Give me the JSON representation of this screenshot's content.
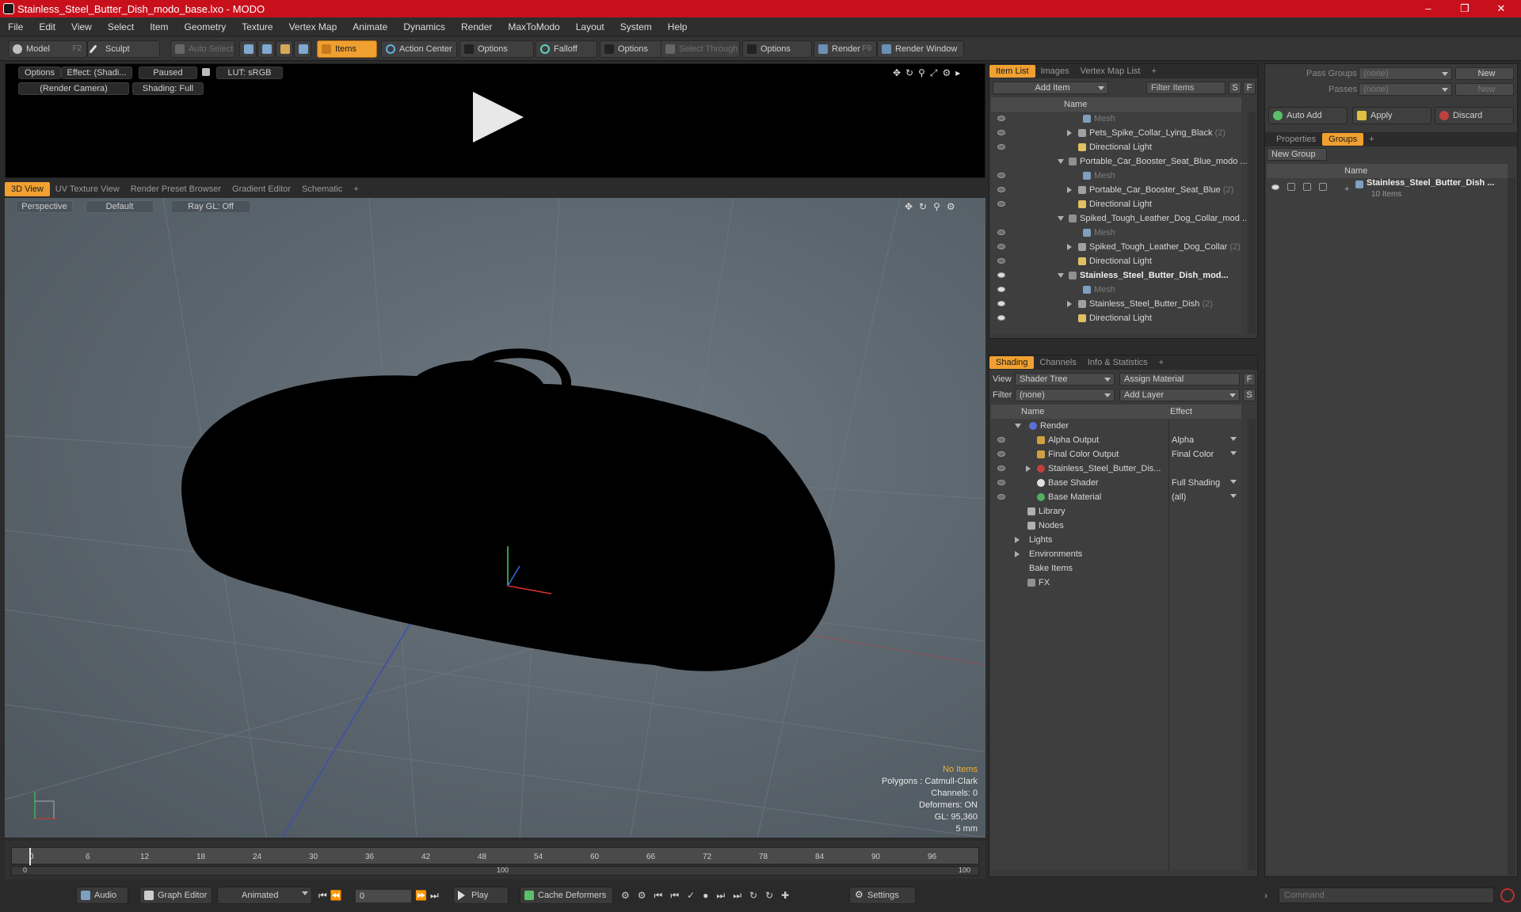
{
  "window": {
    "title": "Stainless_Steel_Butter_Dish_modo_base.lxo - MODO"
  },
  "menu": [
    "File",
    "Edit",
    "View",
    "Select",
    "Item",
    "Geometry",
    "Texture",
    "Vertex Map",
    "Animate",
    "Dynamics",
    "Render",
    "MaxToModo",
    "Layout",
    "System",
    "Help"
  ],
  "toolbar": {
    "model": "Model",
    "model_key": "F2",
    "sculpt": "Sculpt",
    "auto_select": "Auto Select",
    "items": "Items",
    "action_center": "Action Center",
    "options1": "Options",
    "falloff": "Falloff",
    "options2": "Options",
    "select_through": "Select Through",
    "options3": "Options",
    "render": "Render",
    "render_key": "F9",
    "render_window": "Render Window"
  },
  "render_preview": {
    "options": "Options",
    "effect": "Effect: (Shadi...",
    "paused": "Paused",
    "lut": "LUT: sRGB",
    "camera": "(Render Camera)",
    "shading": "Shading: Full"
  },
  "viewport_tabs": [
    "3D View",
    "UV Texture View",
    "Render Preset Browser",
    "Gradient Editor",
    "Schematic",
    "+"
  ],
  "viewport": {
    "perspective": "Perspective",
    "default": "Default",
    "raygl": "Ray GL: Off",
    "info": {
      "no_items": "No Items",
      "polygons": "Polygons : Catmull-Clark",
      "channels": "Channels: 0",
      "deformers": "Deformers: ON",
      "gl": "GL: 95,360",
      "scale": "5 mm"
    }
  },
  "timeline": {
    "ticks": [
      "0",
      "6",
      "12",
      "18",
      "24",
      "30",
      "36",
      "42",
      "48",
      "54",
      "60",
      "66",
      "72",
      "78",
      "84",
      "90",
      "96"
    ],
    "sub_start": "0",
    "sub_mid": "100",
    "sub_end": "100"
  },
  "bottom": {
    "audio": "Audio",
    "graph_editor": "Graph Editor",
    "animated": "Animated",
    "frame": "0",
    "play": "Play",
    "cache_deformers": "Cache Deformers",
    "settings": "Settings",
    "command_placeholder": "Command"
  },
  "item_list": {
    "tabs": [
      "Item List",
      "Images",
      "Vertex Map List",
      "+"
    ],
    "add_item": "Add Item",
    "filter_items": "Filter Items",
    "col_name": "Name",
    "rows": [
      {
        "label": "Mesh",
        "dim": true
      },
      {
        "label": "Pets_Spike_Collar_Lying_Black",
        "count": "(2)"
      },
      {
        "label": "Directional Light"
      },
      {
        "label": "Portable_Car_Booster_Seat_Blue_modo ..."
      },
      {
        "label": "Mesh",
        "dim": true
      },
      {
        "label": "Portable_Car_Booster_Seat_Blue",
        "count": "(2)"
      },
      {
        "label": "Directional Light"
      },
      {
        "label": "Spiked_Tough_Leather_Dog_Collar_mod ..."
      },
      {
        "label": "Mesh",
        "dim": true
      },
      {
        "label": "Spiked_Tough_Leather_Dog_Collar",
        "count": "(2)"
      },
      {
        "label": "Directional Light"
      },
      {
        "label": "Stainless_Steel_Butter_Dish_mod...",
        "bold": true
      },
      {
        "label": "Mesh",
        "dim": true
      },
      {
        "label": "Stainless_Steel_Butter_Dish",
        "count": "(2)"
      },
      {
        "label": "Directional Light"
      }
    ]
  },
  "shading": {
    "tabs": [
      "Shading",
      "Channels",
      "Info & Statistics",
      "+"
    ],
    "view_label": "View",
    "view_value": "Shader Tree",
    "assign_material": "Assign Material",
    "filter_label": "Filter",
    "filter_value": "(none)",
    "add_layer": "Add Layer",
    "col_name": "Name",
    "col_effect": "Effect",
    "rows": [
      {
        "label": "Render",
        "effect": ""
      },
      {
        "label": "Alpha Output",
        "effect": "Alpha"
      },
      {
        "label": "Final Color Output",
        "effect": "Final Color"
      },
      {
        "label": "Stainless_Steel_Butter_Dis...",
        "effect": ""
      },
      {
        "label": "Base Shader",
        "effect": "Full Shading"
      },
      {
        "label": "Base Material",
        "effect": "(all)"
      },
      {
        "label": "Library",
        "effect": ""
      },
      {
        "label": "Nodes",
        "effect": ""
      },
      {
        "label": "Lights",
        "effect": ""
      },
      {
        "label": "Environments",
        "effect": ""
      },
      {
        "label": "Bake Items",
        "effect": ""
      },
      {
        "label": "FX",
        "effect": ""
      }
    ]
  },
  "groups_panel": {
    "pass_groups": "Pass Groups",
    "pass_groups_value": "(none)",
    "new": "New",
    "passes": "Passes",
    "passes_value": "(none)",
    "new2": "New",
    "auto_add": "Auto Add",
    "apply": "Apply",
    "discard": "Discard",
    "tabs": [
      "Properties",
      "Groups",
      "+"
    ],
    "new_group": "New Group",
    "col_name": "Name",
    "group_name": "Stainless_Steel_Butter_Dish ...",
    "group_count": "10 Items"
  }
}
